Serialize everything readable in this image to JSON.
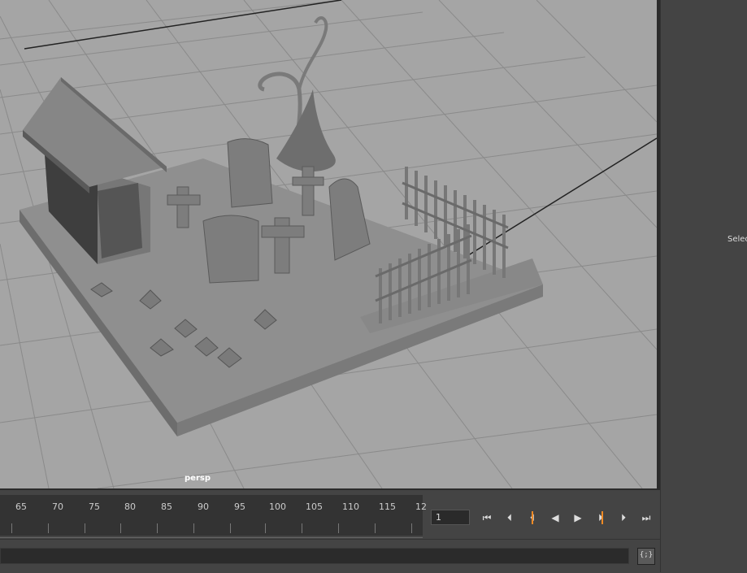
{
  "viewport": {
    "camera_label": "persp",
    "background": "#a5a5a5"
  },
  "right_panel": {
    "select_text": "Selec"
  },
  "timeline": {
    "ticks": [
      "65",
      "70",
      "75",
      "80",
      "85",
      "90",
      "95",
      "100",
      "105",
      "110",
      "115",
      "12"
    ],
    "current_frame": "1",
    "accent": "#f08a24"
  },
  "playback": {
    "go_start": "⏮",
    "step_back": "⏴",
    "prev_key": "⏴",
    "play_back": "◀",
    "play_forward": "▶",
    "next_key": "⏵",
    "step_forward": "⏵",
    "go_end": "⏭"
  },
  "command_line": {
    "script_editor_label": "{;}"
  }
}
